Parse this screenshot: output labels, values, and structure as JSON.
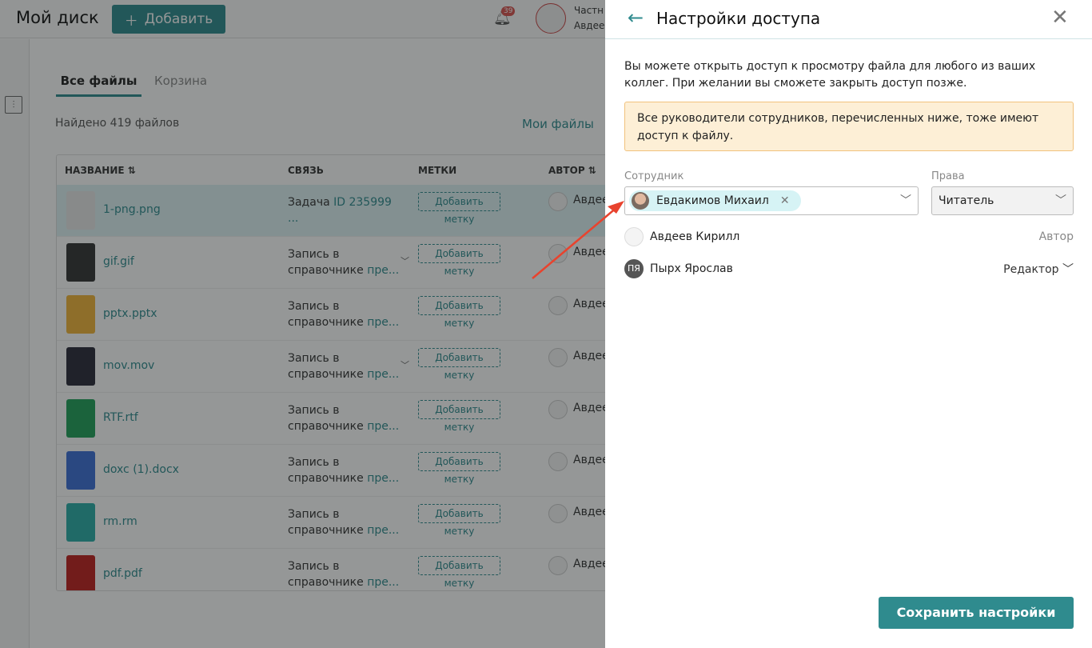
{
  "header": {
    "title": "Мой диск",
    "add_label": "Добавить",
    "notifications": "39",
    "user_line1": "Частн",
    "user_line2": "Авдее"
  },
  "tabs": [
    {
      "label": "Все файлы"
    },
    {
      "label": "Корзина"
    }
  ],
  "found": "Найдено 419 файлов",
  "my_files": "Мои файлы",
  "table": {
    "headers": [
      "НАЗВАНИЕ",
      "СВЯЗЬ",
      "МЕТКИ",
      "АВТОР"
    ],
    "rows": [
      {
        "name": "1-png.png",
        "link_prefix": "Задача",
        "link": "ID 235999 ...",
        "tag": "Добавить метку",
        "author": "Авдее",
        "icon_color": "#e8e8e8"
      },
      {
        "name": "gif.gif",
        "link_prefix": "Запись в справочнике",
        "link": "пре...",
        "tag": "Добавить метку",
        "author": "Авдее",
        "icon_color": "#333333"
      },
      {
        "name": "pptx.pptx",
        "link_prefix": "Запись в справочнике",
        "link": "пре...",
        "tag": "Добавить метку",
        "author": "Авдее",
        "icon_color": "#f2b53a"
      },
      {
        "name": "mov.mov",
        "link_prefix": "Запись в справочнике",
        "link": "пре...",
        "tag": "Добавить метку",
        "author": "Авдее",
        "icon_color": "#2a2a3a"
      },
      {
        "name": "RTF.rtf",
        "link_prefix": "Запись в справочнике",
        "link": "пре...",
        "tag": "Добавить метку",
        "author": "Авдее",
        "icon_color": "#22a05a"
      },
      {
        "name": "doxc (1).docx",
        "link_prefix": "Запись в справочнике",
        "link": "пре...",
        "tag": "Добавить метку",
        "author": "Авдее",
        "icon_color": "#3d6fd8"
      },
      {
        "name": "rm.rm",
        "link_prefix": "Запись в справочнике",
        "link": "пре...",
        "tag": "Добавить метку",
        "author": "Авдее",
        "icon_color": "#2aaea8"
      },
      {
        "name": "pdf.pdf",
        "link_prefix": "Запись в справочнике",
        "link": "пре...",
        "tag": "Добавить метку",
        "author": "Авдее",
        "icon_color": "#c0201e"
      }
    ]
  },
  "panel": {
    "title": "Настройки доступа",
    "description": "Вы можете открыть доступ к просмотру файла для любого из ваших коллег. При желании вы сможете закрыть доступ позже.",
    "warning": "Все руководители сотрудников, перечисленных ниже, тоже имеют доступ к файлу.",
    "employee_label": "Сотрудник",
    "rights_label": "Права",
    "selected_employee": "Евдакимов Михаил",
    "selected_right": "Читатель",
    "people": [
      {
        "name": "Авдеев Кирилл",
        "role": "Автор",
        "initials": ""
      },
      {
        "name": "Пырх Ярослав",
        "role": "Редактор",
        "initials": "ПЯ"
      }
    ],
    "save_label": "Сохранить настройки"
  },
  "colors": {
    "accent": "#2f8b8e",
    "warning_bg": "#fdefd6",
    "annotation": "#e8432e"
  }
}
